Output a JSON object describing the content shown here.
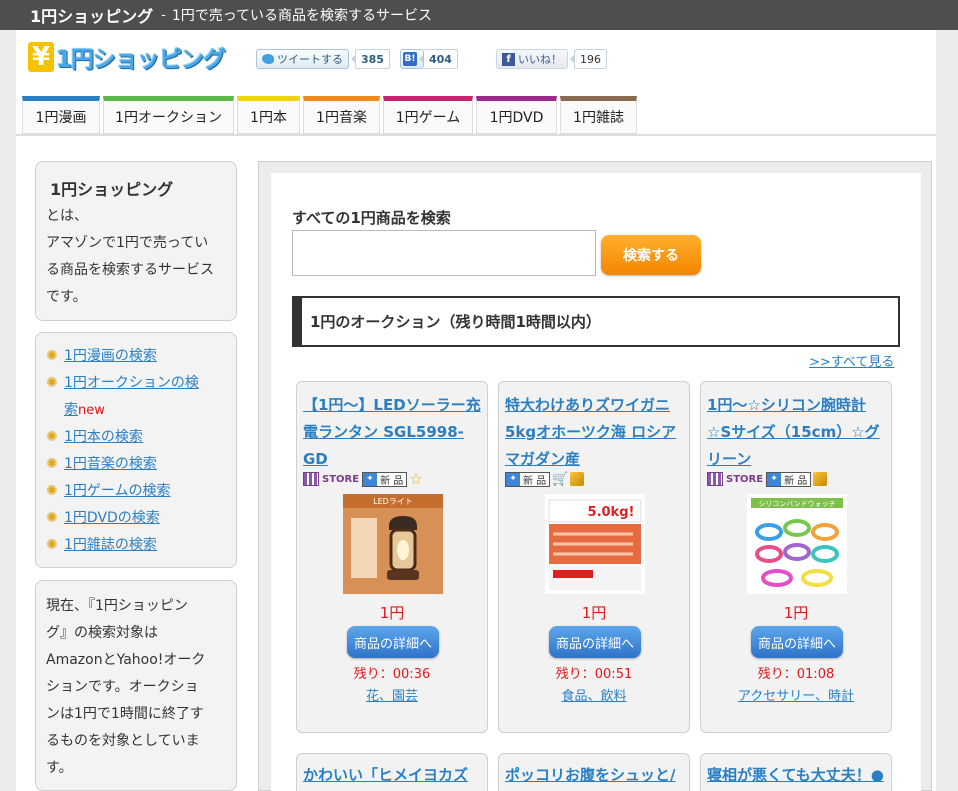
{
  "topbar": {
    "site_name": "1円ショッピング",
    "separator": "-",
    "tagline": "1円で売っている商品を検索するサービス"
  },
  "header": {
    "logo_text": "1円ショッピング",
    "logo_symbol": "¥",
    "social": {
      "tweet_label": "ツイートする",
      "tweet_count": "385",
      "hatena_icon": "B!",
      "hatena_count": "404",
      "facebook_icon": "f",
      "like_label": "いいね！",
      "like_count": "196"
    }
  },
  "tabs": [
    {
      "label": "1円漫画",
      "color": "#2a7fc4"
    },
    {
      "label": "1円オークション",
      "color": "#5db84a"
    },
    {
      "label": "1円本",
      "color": "#f0d21c"
    },
    {
      "label": "1円音楽",
      "color": "#f08a1c"
    },
    {
      "label": "1円ゲーム",
      "color": "#c8236e"
    },
    {
      "label": "1円DVD",
      "color": "#9a2a8a"
    },
    {
      "label": "1円雑誌",
      "color": "#8a6a50"
    }
  ],
  "sidebar": {
    "about_title": "1円ショッピング",
    "about_text_1": "とは、",
    "about_text_2": "アマゾンで1円で売ってい",
    "about_text_3": "る商品を検索するサービス",
    "about_text_4": "です。",
    "links": [
      {
        "label": "1円漫画の検索"
      },
      {
        "label": "1円オークションの検",
        "label_2": "索",
        "new": "new"
      },
      {
        "label": "1円本の検索"
      },
      {
        "label": "1円音楽の検索"
      },
      {
        "label": "1円ゲームの検索"
      },
      {
        "label": "1円DVDの検索"
      },
      {
        "label": "1円雑誌の検索"
      }
    ],
    "notice_lines": [
      "現在、『1円ショッピン",
      "グ』の検索対象は",
      "AmazonとYahoo!オーク",
      "ションです。オークショ",
      "ンは1円で1時間に終了す",
      "るものを対象としていま",
      "す。"
    ]
  },
  "main": {
    "search_label": "すべての1円商品を検索",
    "search_value": "",
    "search_button": "検索する",
    "section_title": "1円のオークション（残り時間1時間以内）",
    "see_all": ">>すべて見る",
    "detail_button": "商品の詳細へ",
    "items": [
      {
        "title": "【1円〜】LEDソーラー充電ランタン SGL5998-GD",
        "badges": [
          "store",
          "new",
          "star"
        ],
        "store_label": "STORE",
        "new_label": "新 品",
        "price": "1円",
        "remaining": "残り：00:36",
        "category": "花、園芸",
        "image_caption": "LEDライト"
      },
      {
        "title": "特大わけありズワイガニ 5kgオホーツク海 ロシアマガダン産",
        "badges": [
          "new",
          "cart",
          "ship"
        ],
        "store_label": "",
        "new_label": "新 品",
        "price": "1円",
        "remaining": "残り：00:51",
        "category": "食品、飲料",
        "image_caption": "5.0kg!"
      },
      {
        "title": "1円〜☆シリコン腕時計☆Sサイズ（15cm）☆グリーン",
        "badges": [
          "store",
          "new",
          "ship"
        ],
        "store_label": "STORE",
        "new_label": "新 品",
        "price": "1円",
        "remaining": "残り：01:08",
        "category": "アクセサリー、時計",
        "image_caption": "シリコンバンドウォッチ"
      }
    ],
    "next_row": [
      {
        "title": "かわいい「ヒメイヨカズ"
      },
      {
        "title": "ポッコリお腹をシュッと/"
      },
      {
        "title": "寝相が悪くても大丈夫！●"
      }
    ]
  }
}
